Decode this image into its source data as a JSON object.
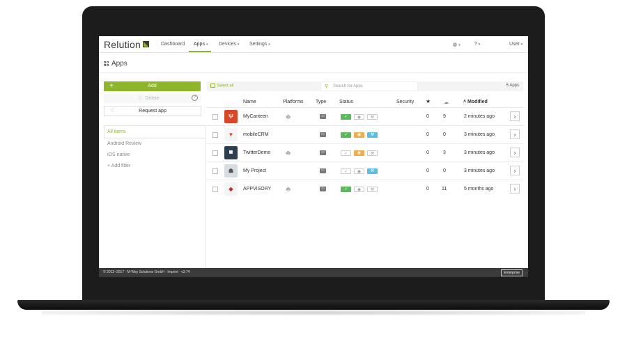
{
  "header": {
    "logo_text": "Relution",
    "nav": [
      {
        "label": "Dashboard"
      },
      {
        "label": "Apps"
      },
      {
        "label": "Devices"
      },
      {
        "label": "Settings"
      }
    ],
    "user_label": "User"
  },
  "page": {
    "title": "Apps"
  },
  "actions": {
    "add_label": "Add",
    "delete_label": "Delete",
    "request_label": "Request app"
  },
  "filters": {
    "items": [
      "All items",
      "Android Review",
      "iOS native",
      "+ Add filter"
    ]
  },
  "toolbar": {
    "select_all": "Select all",
    "search_placeholder": "Search for Apps",
    "count": "5 Apps"
  },
  "table": {
    "headers": {
      "name": "Name",
      "platforms": "Platforms",
      "type": "Type",
      "status": "Status",
      "security": "Security",
      "modified": "Modified"
    },
    "rows": [
      {
        "name": "MyCanteen",
        "stars": "0",
        "downloads": "9",
        "modified": "2 minutes ago"
      },
      {
        "name": "mobileCRM",
        "stars": "0",
        "downloads": "0",
        "modified": "3 minutes ago"
      },
      {
        "name": "TwitterDemo",
        "stars": "0",
        "downloads": "3",
        "modified": "3 minutes ago"
      },
      {
        "name": "My Project",
        "stars": "0",
        "downloads": "0",
        "modified": "3 minutes ago"
      },
      {
        "name": "APPVISORY",
        "stars": "0",
        "downloads": "11",
        "modified": "5 months ago"
      }
    ]
  },
  "footer": {
    "copyright": "© 2013–2017 · M-Way Solutions GmbH · Imprint · v3.74",
    "edition": "Enterprise"
  },
  "colors": {
    "accent": "#8fb52a",
    "status_ok": "#5cb85c",
    "status_eye": "#f0ad4e",
    "status_wrench": "#5bc0de",
    "laptop_frame": "#1c1c1c"
  },
  "icons": [
    "apps-grid-icon",
    "plus-icon",
    "trash-icon",
    "help-icon",
    "heart-icon",
    "search-icon",
    "android-icon",
    "apple-icon",
    "star-icon",
    "download-icon",
    "sort-up-icon",
    "chevron-right-icon",
    "check-icon",
    "eye-icon",
    "wrench-icon",
    "globe-icon"
  ]
}
